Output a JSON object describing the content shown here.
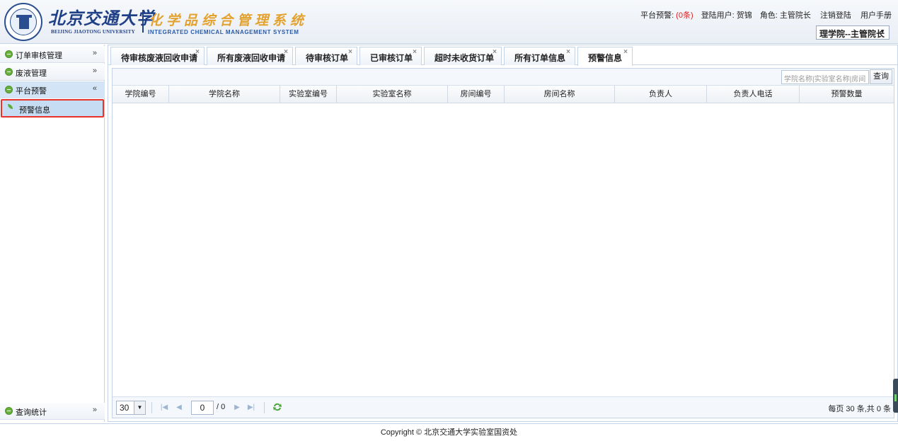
{
  "header": {
    "university_cn": "北京交通大学",
    "university_en": "BEIJING JIAOTONG UNIVERSITY",
    "system_cn": "化学品综合管理系统",
    "system_en": "INTEGRATED CHEMICAL MANAGEMENT SYSTEM",
    "platform_warning_label": "平台预警:",
    "platform_warning_count": "(0条)",
    "login_user_label": "登陆用户:",
    "login_user": "贺锦",
    "role_label": "角色:",
    "role": "主管院长",
    "logout": "注销登陆",
    "manual": "用户手册",
    "role_select": "理学院--主管院长"
  },
  "sidebar": {
    "items": [
      {
        "label": "订单审核管理",
        "chevron": "»"
      },
      {
        "label": "废液管理",
        "chevron": "»"
      },
      {
        "label": "平台预警",
        "chevron": "«"
      },
      {
        "label": "查询统计",
        "chevron": "»"
      }
    ],
    "sub_item": "预警信息"
  },
  "tabs": [
    {
      "label": "待审核废液回收申请"
    },
    {
      "label": "所有废液回收申请"
    },
    {
      "label": "待审核订单"
    },
    {
      "label": "已审核订单"
    },
    {
      "label": "超时未收货订单"
    },
    {
      "label": "所有订单信息"
    },
    {
      "label": "预警信息"
    }
  ],
  "close_glyph": "×",
  "toolbar": {
    "search_placeholder": "学院名称|实验室名称|房间",
    "query_button": "查询"
  },
  "table": {
    "columns": [
      "学院编号",
      "学院名称",
      "实验室编号",
      "实验室名称",
      "房间编号",
      "房间名称",
      "负责人",
      "负责人电话",
      "预警数量"
    ]
  },
  "pager": {
    "page_size": "30",
    "current_page": "0",
    "total_pages": "/ 0",
    "info": "每页 30 条,共 0 条"
  },
  "footer": {
    "copyright": "Copyright © 北京交通大学实验室国资处"
  },
  "colors": {
    "brand_blue": "#1f3f86",
    "system_gold": "#e3a12e",
    "warning_red": "#e01d1d",
    "highlight_border": "#e8322b",
    "menu_green": "#66b23a"
  }
}
